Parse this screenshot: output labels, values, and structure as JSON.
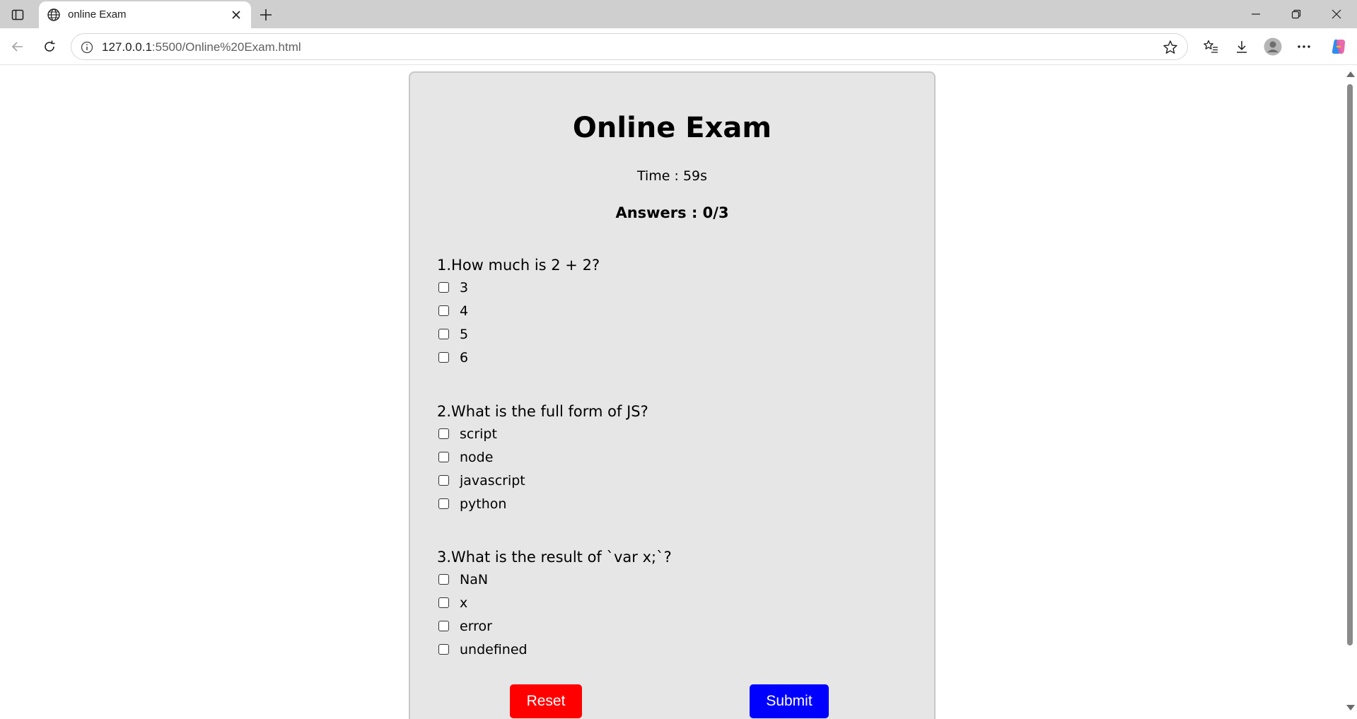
{
  "browser": {
    "tab_title": "online Exam",
    "url_host": "127.0.0.1",
    "url_path": ":5500/Online%20Exam.html",
    "icons": {
      "sidebar": "sidebar-toggle-icon",
      "tab": "globe-icon",
      "close": "close-icon",
      "new_tab": "plus-icon",
      "back": "back-arrow-icon",
      "reload": "reload-icon",
      "info": "info-icon",
      "favorite": "star-icon",
      "favorites": "favorites-icon",
      "downloads": "download-icon",
      "profile": "profile-icon",
      "menu": "more-icon",
      "copilot": "copilot-icon"
    }
  },
  "exam": {
    "title": "Online Exam",
    "timer": "Time : 59s",
    "answers": "Answers : 0/3",
    "questions": [
      {
        "text": "1.How much is 2 + 2?",
        "options": [
          "3",
          "4",
          "5",
          "6"
        ]
      },
      {
        "text": "2.What is the full form of JS?",
        "options": [
          "script",
          "node",
          "javascript",
          "python"
        ]
      },
      {
        "text": "3.What is the result of `var x;`?",
        "options": [
          "NaN",
          "x",
          "error",
          "undefined"
        ]
      }
    ],
    "reset_label": "Reset",
    "submit_label": "Submit"
  },
  "colors": {
    "card_bg": "#e6e6e6",
    "reset_button": "#ff0000",
    "submit_button": "#0000ff"
  }
}
